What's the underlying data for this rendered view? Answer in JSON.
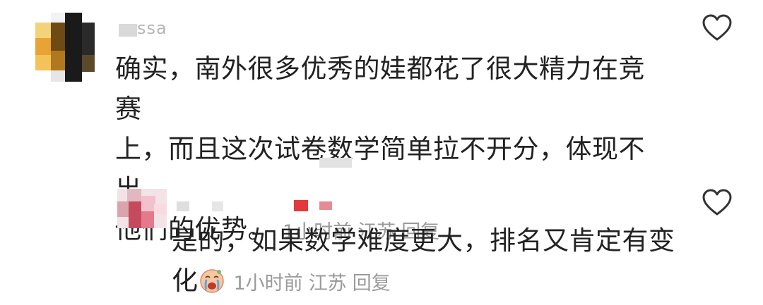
{
  "comments": [
    {
      "username": "ssa",
      "text_lines": [
        "确实，南外很多优秀的娃都花了很大精力在竞赛",
        "上，而且这次试卷数学简单拉不开分，体现不出",
        "他们的优势。"
      ],
      "time": "1小时前",
      "location": "江苏",
      "reply_label": "回复",
      "like_icon": "heart-outline-icon"
    },
    {
      "username": "",
      "text_lines": [
        "是的，如果数学难度更大，排名又肯定有变",
        "化"
      ],
      "emoji_icon": "crying-face-emoji",
      "time": "1小时前",
      "location": "江苏",
      "reply_label": "回复",
      "like_icon": "heart-outline-icon"
    }
  ],
  "colors": {
    "text": "#222222",
    "meta": "#9a9a9a",
    "icon": "#333333"
  }
}
